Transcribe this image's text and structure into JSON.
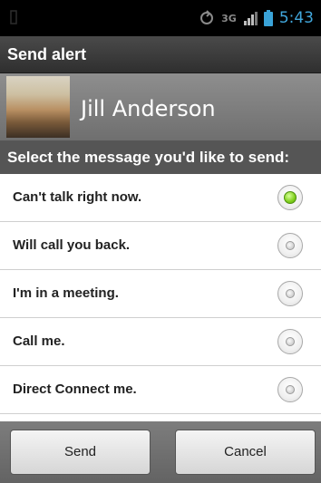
{
  "status_bar": {
    "time": "5:43",
    "network_type": "3G",
    "icons": [
      "notification-icon",
      "sync-icon",
      "3g-icon",
      "signal-icon",
      "battery-icon"
    ]
  },
  "title": "Send alert",
  "contact": {
    "name": "Jill Anderson"
  },
  "prompt": "Select the message you'd like to send:",
  "options": [
    {
      "label": "Can't talk right now.",
      "selected": true
    },
    {
      "label": "Will call you back.",
      "selected": false
    },
    {
      "label": "I'm in a meeting.",
      "selected": false
    },
    {
      "label": "Call me.",
      "selected": false
    },
    {
      "label": "Direct Connect me.",
      "selected": false
    }
  ],
  "buttons": {
    "send": "Send",
    "cancel": "Cancel"
  },
  "colors": {
    "status_blue": "#41a7dc",
    "radio_selected": "#7fcf1b"
  }
}
